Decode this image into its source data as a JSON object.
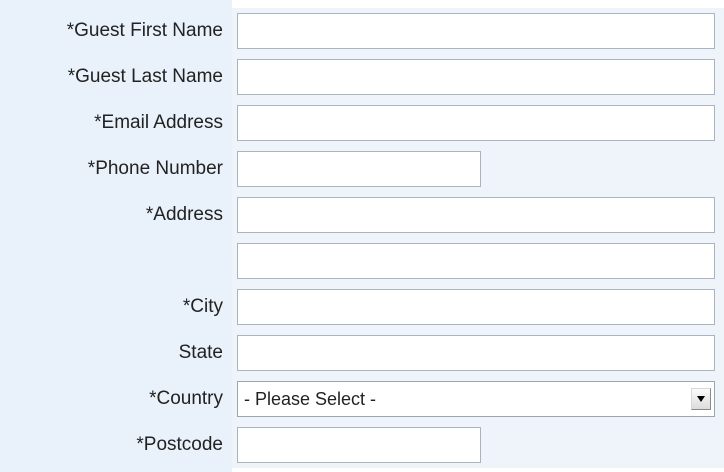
{
  "form": {
    "fields": {
      "first_name": {
        "label": "*Guest First Name",
        "value": ""
      },
      "last_name": {
        "label": "*Guest Last Name",
        "value": ""
      },
      "email": {
        "label": "*Email Address",
        "value": ""
      },
      "phone": {
        "label": "*Phone Number",
        "value": ""
      },
      "address": {
        "label": "*Address",
        "value": "",
        "line2_value": ""
      },
      "city": {
        "label": "*City",
        "value": ""
      },
      "state": {
        "label": "State",
        "value": ""
      },
      "country": {
        "label": "*Country",
        "selected": "- Please Select -"
      },
      "postcode": {
        "label": "*Postcode",
        "value": ""
      }
    },
    "icons": {
      "country_dropdown": "chevron-down-icon"
    },
    "colors": {
      "label_background": "#e9f1fa",
      "field_background": "#eff4fa",
      "input_border": "#a9b4c0",
      "text": "#222222"
    }
  }
}
